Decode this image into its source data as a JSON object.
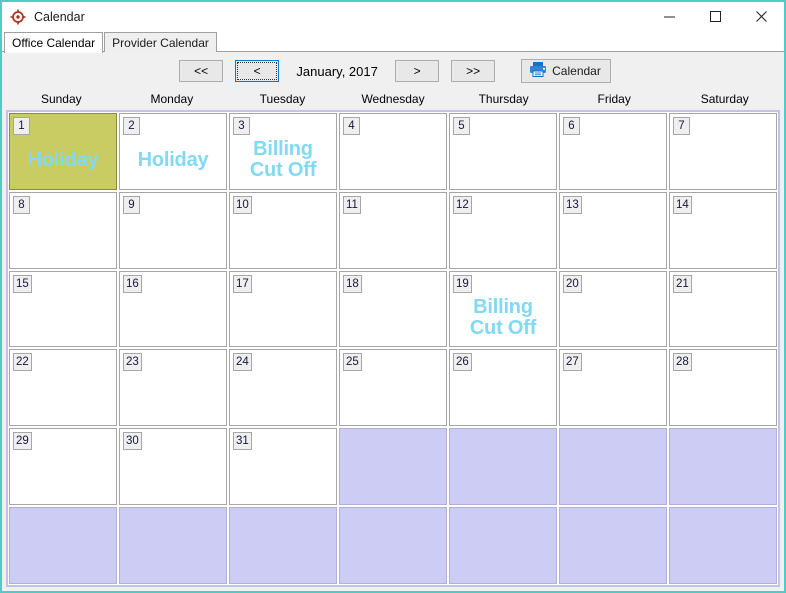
{
  "window": {
    "title": "Calendar",
    "icon": "target-crosshair-icon",
    "border_color": "#4ecdc4",
    "controls": {
      "minimize": "minimize-icon",
      "maximize": "maximize-icon",
      "close": "close-icon"
    }
  },
  "tabs": [
    {
      "label": "Office Calendar",
      "active": true
    },
    {
      "label": "Provider Calendar",
      "active": false
    }
  ],
  "toolbar": {
    "first_label": "<<",
    "prev_label": "<",
    "month_label": "January, 2017",
    "next_label": ">",
    "last_label": ">>",
    "print_label": "Calendar",
    "print_icon": "printer-icon",
    "focused_button": "prev"
  },
  "day_headers": [
    "Sunday",
    "Monday",
    "Tuesday",
    "Wednesday",
    "Thursday",
    "Friday",
    "Saturday"
  ],
  "colors": {
    "selected_day": "#c9cc63",
    "event_text": "#82d9f2",
    "empty_cell": "#ccccf5",
    "grid_frame": "#c3c3ea",
    "toolbar_bg": "#f0f0f0"
  },
  "weeks": [
    [
      {
        "day": "1",
        "event": "Holiday",
        "selected": true,
        "empty": false
      },
      {
        "day": "2",
        "event": "Holiday",
        "selected": false,
        "empty": false
      },
      {
        "day": "3",
        "event": "Billing\nCut Off",
        "selected": false,
        "empty": false
      },
      {
        "day": "4",
        "event": "",
        "selected": false,
        "empty": false
      },
      {
        "day": "5",
        "event": "",
        "selected": false,
        "empty": false
      },
      {
        "day": "6",
        "event": "",
        "selected": false,
        "empty": false
      },
      {
        "day": "7",
        "event": "",
        "selected": false,
        "empty": false
      }
    ],
    [
      {
        "day": "8",
        "event": "",
        "selected": false,
        "empty": false
      },
      {
        "day": "9",
        "event": "",
        "selected": false,
        "empty": false
      },
      {
        "day": "10",
        "event": "",
        "selected": false,
        "empty": false
      },
      {
        "day": "11",
        "event": "",
        "selected": false,
        "empty": false
      },
      {
        "day": "12",
        "event": "",
        "selected": false,
        "empty": false
      },
      {
        "day": "13",
        "event": "",
        "selected": false,
        "empty": false
      },
      {
        "day": "14",
        "event": "",
        "selected": false,
        "empty": false
      }
    ],
    [
      {
        "day": "15",
        "event": "",
        "selected": false,
        "empty": false
      },
      {
        "day": "16",
        "event": "",
        "selected": false,
        "empty": false
      },
      {
        "day": "17",
        "event": "",
        "selected": false,
        "empty": false
      },
      {
        "day": "18",
        "event": "",
        "selected": false,
        "empty": false
      },
      {
        "day": "19",
        "event": "Billing\nCut Off",
        "selected": false,
        "empty": false
      },
      {
        "day": "20",
        "event": "",
        "selected": false,
        "empty": false
      },
      {
        "day": "21",
        "event": "",
        "selected": false,
        "empty": false
      }
    ],
    [
      {
        "day": "22",
        "event": "",
        "selected": false,
        "empty": false
      },
      {
        "day": "23",
        "event": "",
        "selected": false,
        "empty": false
      },
      {
        "day": "24",
        "event": "",
        "selected": false,
        "empty": false
      },
      {
        "day": "25",
        "event": "",
        "selected": false,
        "empty": false
      },
      {
        "day": "26",
        "event": "",
        "selected": false,
        "empty": false
      },
      {
        "day": "27",
        "event": "",
        "selected": false,
        "empty": false
      },
      {
        "day": "28",
        "event": "",
        "selected": false,
        "empty": false
      }
    ],
    [
      {
        "day": "29",
        "event": "",
        "selected": false,
        "empty": false
      },
      {
        "day": "30",
        "event": "",
        "selected": false,
        "empty": false
      },
      {
        "day": "31",
        "event": "",
        "selected": false,
        "empty": false
      },
      {
        "day": "",
        "event": "",
        "selected": false,
        "empty": true
      },
      {
        "day": "",
        "event": "",
        "selected": false,
        "empty": true
      },
      {
        "day": "",
        "event": "",
        "selected": false,
        "empty": true
      },
      {
        "day": "",
        "event": "",
        "selected": false,
        "empty": true
      }
    ],
    [
      {
        "day": "",
        "event": "",
        "selected": false,
        "empty": true
      },
      {
        "day": "",
        "event": "",
        "selected": false,
        "empty": true
      },
      {
        "day": "",
        "event": "",
        "selected": false,
        "empty": true
      },
      {
        "day": "",
        "event": "",
        "selected": false,
        "empty": true
      },
      {
        "day": "",
        "event": "",
        "selected": false,
        "empty": true
      },
      {
        "day": "",
        "event": "",
        "selected": false,
        "empty": true
      },
      {
        "day": "",
        "event": "",
        "selected": false,
        "empty": true
      }
    ]
  ]
}
